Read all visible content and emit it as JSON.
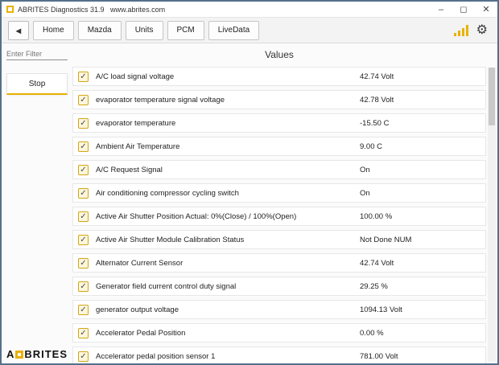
{
  "window": {
    "title": "ABRITES Diagnostics 31.9   www.abrites.com",
    "controls": {
      "minimize": "–",
      "maximize": "◻",
      "close": "✕"
    }
  },
  "toolbar": {
    "back_label": "◂",
    "tabs": [
      "Home",
      "Mazda",
      "Units",
      "PCM",
      "LiveData"
    ],
    "icons": {
      "gear": "⚙",
      "signal": "signal-bars"
    }
  },
  "sidebar": {
    "filter_placeholder": "Enter Filter",
    "stop_label": "Stop",
    "logo": {
      "left": "A",
      "right": "BRITES"
    }
  },
  "main": {
    "header": "Values",
    "checkbox_glyph": "✓",
    "rows": [
      {
        "label": "A/C  load signal voltage",
        "value": "42.74 Volt",
        "checked": true
      },
      {
        "label": "evaporator temperature signal voltage",
        "value": "42.78 Volt",
        "checked": true
      },
      {
        "label": "evaporator temperature",
        "value": "-15.50 C",
        "checked": true
      },
      {
        "label": "Ambient Air Temperature",
        "value": "9.00 C",
        "checked": true
      },
      {
        "label": "A/C Request Signal",
        "value": "On",
        "checked": true
      },
      {
        "label": "Air conditioning compressor cycling switch",
        "value": "On",
        "checked": true
      },
      {
        "label": "Active Air Shutter Position Actual: 0%(Close) / 100%(Open)",
        "value": "100.00 %",
        "checked": true
      },
      {
        "label": "Active Air Shutter Module Calibration Status",
        "value": "Not Done NUM",
        "checked": true
      },
      {
        "label": "Alternator Current Sensor",
        "value": "42.74 Volt",
        "checked": true
      },
      {
        "label": "Generator field current control duty signal",
        "value": "29.25 %",
        "checked": true
      },
      {
        "label": "generator output voltage",
        "value": "1094.13 Volt",
        "checked": true
      },
      {
        "label": "Accelerator Pedal Position",
        "value": "0.00 %",
        "checked": true
      },
      {
        "label": "Accelerator pedal position sensor 1",
        "value": "781.00 Volt",
        "checked": true
      }
    ]
  },
  "colors": {
    "accent": "#e9b200",
    "checkbox_border": "#d2a713",
    "window_border": "#54708a"
  }
}
